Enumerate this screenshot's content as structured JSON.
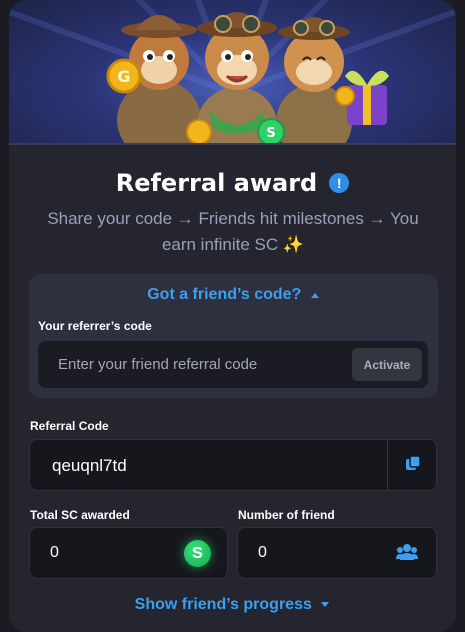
{
  "header": {
    "title": "Referral award",
    "info_icon": "info-icon",
    "subtitle": "Share your code → Friends hit milestones → You earn infinite SC ✨"
  },
  "friend_code": {
    "toggle_label": "Got a friend’s code?",
    "toggle_icon": "caret-up-icon",
    "field_label": "Your referrer’s code",
    "placeholder": "Enter your friend referral code",
    "value": "",
    "activate_label": "Activate"
  },
  "referral": {
    "label": "Referral Code",
    "code": "qeuqnl7td",
    "copy_icon": "copy-icon"
  },
  "stats": {
    "total_sc": {
      "label": "Total SC awarded",
      "value": "0",
      "icon": "sc-coin-icon",
      "icon_text": "S"
    },
    "friends": {
      "label": "Number of friend",
      "value": "0",
      "icon": "friends-icon"
    }
  },
  "progress_toggle": {
    "label": "Show friend’s progress",
    "icon": "caret-down-icon"
  },
  "colors": {
    "accent_blue": "#3aa0ef",
    "card_bg": "#24252e",
    "panel_bg": "#2e3040",
    "input_bg": "#16171d",
    "sc_green": "#1ec25a"
  }
}
